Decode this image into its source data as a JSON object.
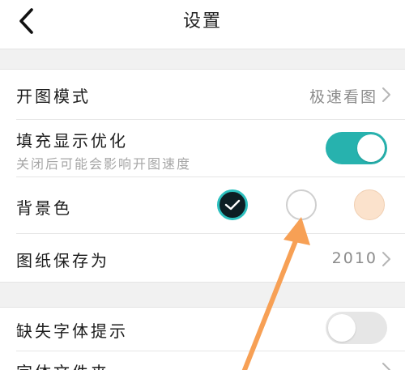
{
  "header": {
    "title": "设置"
  },
  "settings": {
    "open_mode": {
      "label": "开图模式",
      "value": "极速看图"
    },
    "fill_display": {
      "label": "填充显示优化",
      "sublabel": "关闭后可能会影响开图速度",
      "enabled": true
    },
    "background_color": {
      "label": "背景色",
      "options": [
        "dark",
        "white",
        "beige"
      ],
      "selected": "dark"
    },
    "save_as": {
      "label": "图纸保存为",
      "value": "2010"
    },
    "missing_font": {
      "label": "缺失字体提示",
      "enabled": false
    },
    "font_folder": {
      "label": "字体文件夹"
    }
  },
  "colors": {
    "accent": "#27b2ae",
    "annotation_arrow": "#f7a055",
    "swatch_dark": "#0d1e24",
    "swatch_white": "#ffffff",
    "swatch_beige": "#fbe2cc"
  },
  "icons": {
    "back": "chevron-left-icon",
    "row_chevron": "chevron-right-icon",
    "selected": "checkmark-icon"
  }
}
